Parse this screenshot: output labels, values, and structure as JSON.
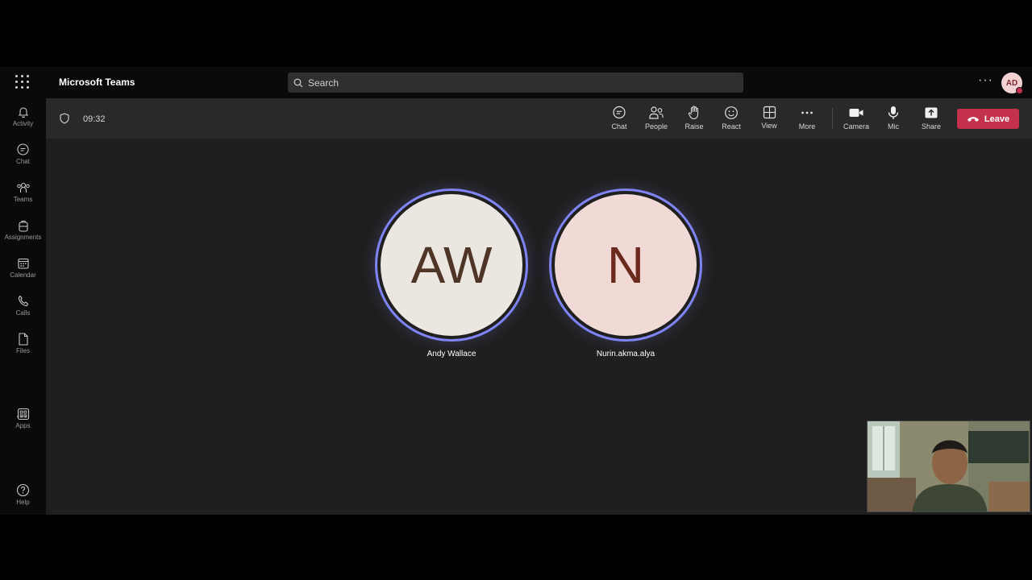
{
  "app": {
    "title": "Microsoft Teams"
  },
  "search": {
    "placeholder": "Search"
  },
  "user": {
    "initials": "AD",
    "status_color": "#c4314b"
  },
  "rail": [
    {
      "id": "activity",
      "label": "Activity",
      "icon": "bell-icon"
    },
    {
      "id": "chat",
      "label": "Chat",
      "icon": "chat-icon"
    },
    {
      "id": "teams",
      "label": "Teams",
      "icon": "teams-icon"
    },
    {
      "id": "assignments",
      "label": "Assignments",
      "icon": "backpack-icon"
    },
    {
      "id": "calendar",
      "label": "Calendar",
      "icon": "calendar-icon"
    },
    {
      "id": "calls",
      "label": "Calls",
      "icon": "phone-icon"
    },
    {
      "id": "files",
      "label": "Files",
      "icon": "file-icon"
    },
    {
      "id": "more",
      "label": "...",
      "icon": "more-icon"
    },
    {
      "id": "apps",
      "label": "Apps",
      "icon": "apps-icon"
    },
    {
      "id": "help",
      "label": "Help",
      "icon": "help-icon"
    }
  ],
  "meeting": {
    "timer": "09:32",
    "controls": [
      {
        "id": "chat",
        "label": "Chat",
        "icon": "chat-bubble-icon"
      },
      {
        "id": "people",
        "label": "People",
        "icon": "people-icon"
      },
      {
        "id": "raise",
        "label": "Raise",
        "icon": "hand-icon"
      },
      {
        "id": "react",
        "label": "React",
        "icon": "smiley-icon"
      },
      {
        "id": "view",
        "label": "View",
        "icon": "grid-icon"
      },
      {
        "id": "more",
        "label": "More",
        "icon": "ellipsis-icon"
      },
      {
        "id": "camera",
        "label": "Camera",
        "icon": "camera-icon"
      },
      {
        "id": "mic",
        "label": "Mic",
        "icon": "mic-icon"
      },
      {
        "id": "share",
        "label": "Share",
        "icon": "share-icon"
      }
    ],
    "leave_label": "Leave"
  },
  "participants": [
    {
      "initials": "AW",
      "name": "Andy Wallace",
      "bg": "#ece6e1",
      "fg": "#4e3526"
    },
    {
      "initials": "N",
      "name": "Nurin.akma.alya",
      "bg": "#f1d9d6",
      "fg": "#6b2a1d"
    }
  ],
  "colors": {
    "accent_ring": "#7f85f5",
    "leave": "#c4314b"
  }
}
